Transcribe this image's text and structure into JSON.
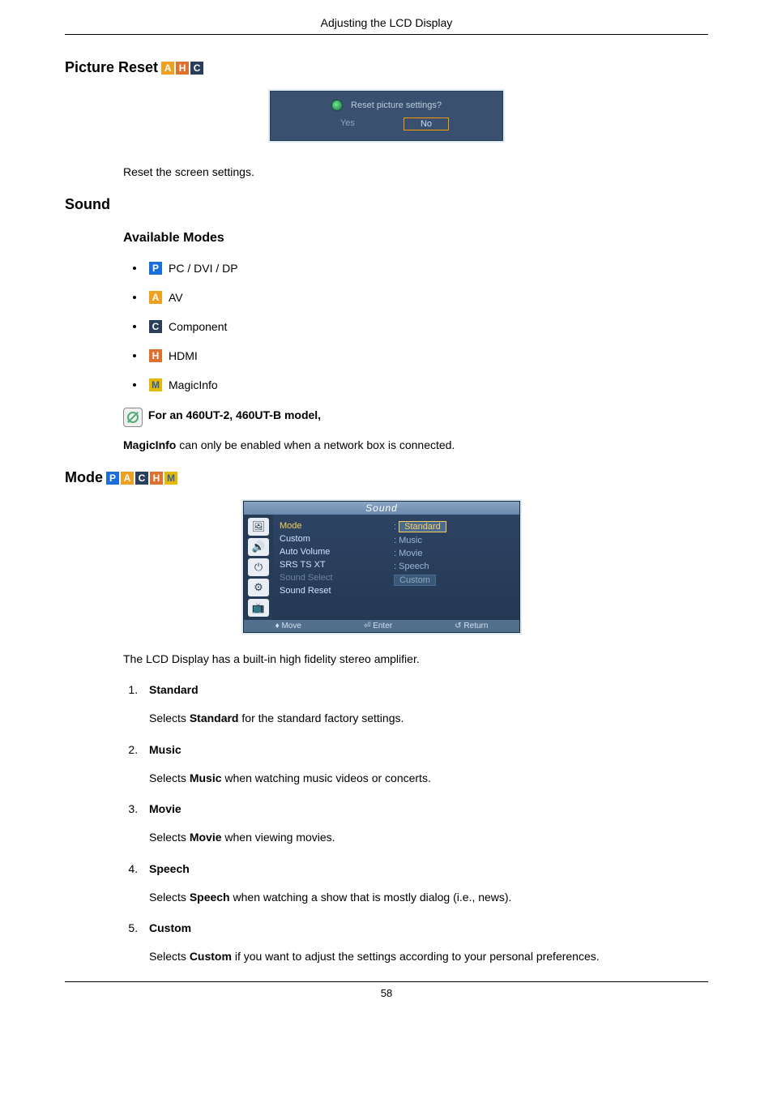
{
  "header": {
    "title": "Adjusting the LCD Display"
  },
  "section_picture_reset": {
    "title": "Picture Reset",
    "dialog": {
      "question": "Reset picture settings?",
      "yes": "Yes",
      "no": "No"
    },
    "description": "Reset the screen settings."
  },
  "section_sound": {
    "title": "Sound",
    "available_modes_title": "Available Modes",
    "modes": {
      "pc": "PC / DVI / DP",
      "av": "AV",
      "component": "Component",
      "hdmi": "HDMI",
      "magicinfo": "MagicInfo"
    },
    "note_model": "For an 460UT-2, 460UT-B model,",
    "note_body_prefix": "MagicInfo",
    "note_body_rest": " can only be enabled when a network box is connected."
  },
  "section_mode": {
    "title": "Mode",
    "osd": {
      "window_title": "Sound",
      "menu": {
        "mode": "Mode",
        "custom": "Custom",
        "auto_volume": "Auto Volume",
        "srs": "SRS TS XT",
        "sound_select": "Sound Select",
        "sound_reset": "Sound Reset"
      },
      "values": {
        "standard": "Standard",
        "music": "Music",
        "movie": "Movie",
        "speech": "Speech",
        "custom": "Custom"
      },
      "footer": {
        "move": "Move",
        "enter": "Enter",
        "return": "Return"
      }
    },
    "intro": "The LCD Display has a built-in high fidelity stereo amplifier.",
    "items": [
      {
        "title": "Standard",
        "pre": "Selects ",
        "bold": "Standard",
        "post": " for the standard factory settings."
      },
      {
        "title": "Music",
        "pre": "Selects ",
        "bold": "Music",
        "post": " when watching music videos or concerts."
      },
      {
        "title": "Movie",
        "pre": "Selects ",
        "bold": "Movie",
        "post": " when viewing movies."
      },
      {
        "title": "Speech",
        "pre": "Selects ",
        "bold": "Speech",
        "post": " when watching a show that is mostly dialog (i.e., news)."
      },
      {
        "title": "Custom",
        "pre": "Selects ",
        "bold": "Custom",
        "post": " if you want to adjust the settings according to your personal preferences."
      }
    ]
  },
  "page_number": "58",
  "icon_letters": {
    "p": "P",
    "a": "A",
    "c": "C",
    "h": "H",
    "m": "M"
  }
}
